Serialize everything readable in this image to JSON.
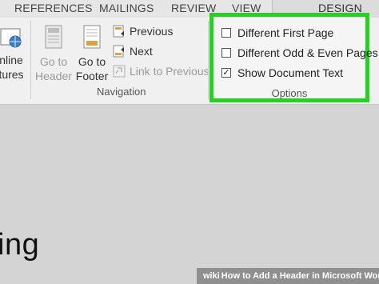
{
  "tabs": [
    "REFERENCES",
    "MAILINGS",
    "REVIEW",
    "VIEW",
    "DESIGN"
  ],
  "ribbon": {
    "partial_button_label_1": "nline",
    "partial_button_label_2": "tures",
    "go_to_header": {
      "line1": "Go to",
      "line2": "Header"
    },
    "go_to_footer": {
      "line1": "Go to",
      "line2": "Footer"
    },
    "previous": "Previous",
    "next": "Next",
    "link_to_previous": "Link to Previous",
    "navigation_group": "Navigation"
  },
  "options": {
    "items": [
      {
        "label": "Different First Page",
        "checked": false
      },
      {
        "label": "Different Odd & Even Pages",
        "checked": false
      },
      {
        "label": "Show Document Text",
        "checked": true
      }
    ],
    "group_label": "Options",
    "highlight_color": "#22d31f"
  },
  "document": {
    "partial_text": "ing"
  },
  "watermark": {
    "brand": "wiki",
    "text": "How to Add a Header in Microsoft Word"
  }
}
